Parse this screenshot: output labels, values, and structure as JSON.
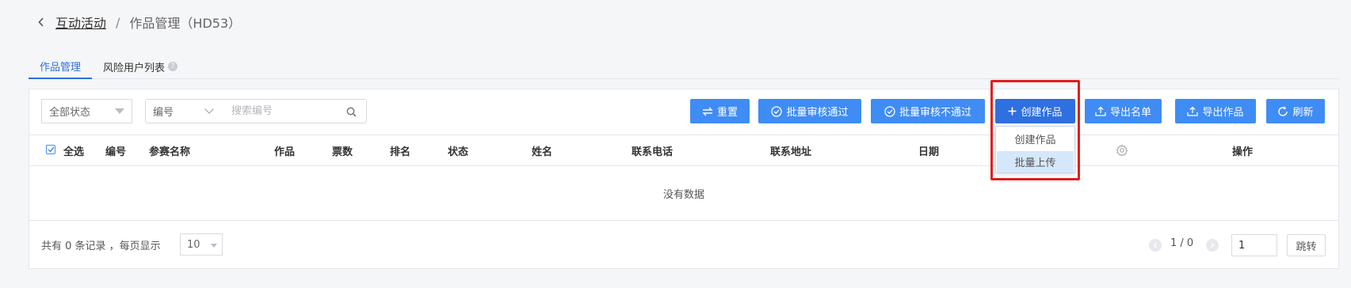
{
  "breadcrumb": {
    "parent": "互动活动",
    "separator": "/",
    "current": "作品管理（HD53）"
  },
  "tabs": [
    {
      "label": "作品管理",
      "active": true
    },
    {
      "label": "风险用户列表",
      "active": false
    }
  ],
  "filters": {
    "status_value": "全部状态",
    "field_value": "编号",
    "search_placeholder": "搜索编号"
  },
  "toolbar": {
    "reset": "重置",
    "approve": "批量审核通过",
    "reject": "批量审核不通过",
    "create": "创建作品",
    "export_list": "导出名单",
    "export_works": "导出作品",
    "refresh": "刷新"
  },
  "create_menu": {
    "items": [
      "创建作品",
      "批量上传"
    ],
    "hovered": "批量上传"
  },
  "table": {
    "select_all": "全选",
    "columns": [
      "编号",
      "参赛名称",
      "作品",
      "票数",
      "排名",
      "状态",
      "姓名",
      "联系电话",
      "联系地址",
      "日期",
      "操作"
    ],
    "empty_text": "没有数据"
  },
  "pagination": {
    "total_text": "共有 0 条记录 ，每页显示",
    "page_size": "10",
    "page_info": "1 / 0",
    "jump_value": "1",
    "jump_label": "跳转"
  },
  "colors": {
    "primary": "#3f8cf5",
    "primary_dark": "#2f6fe0",
    "highlight": "#e41c1c"
  }
}
